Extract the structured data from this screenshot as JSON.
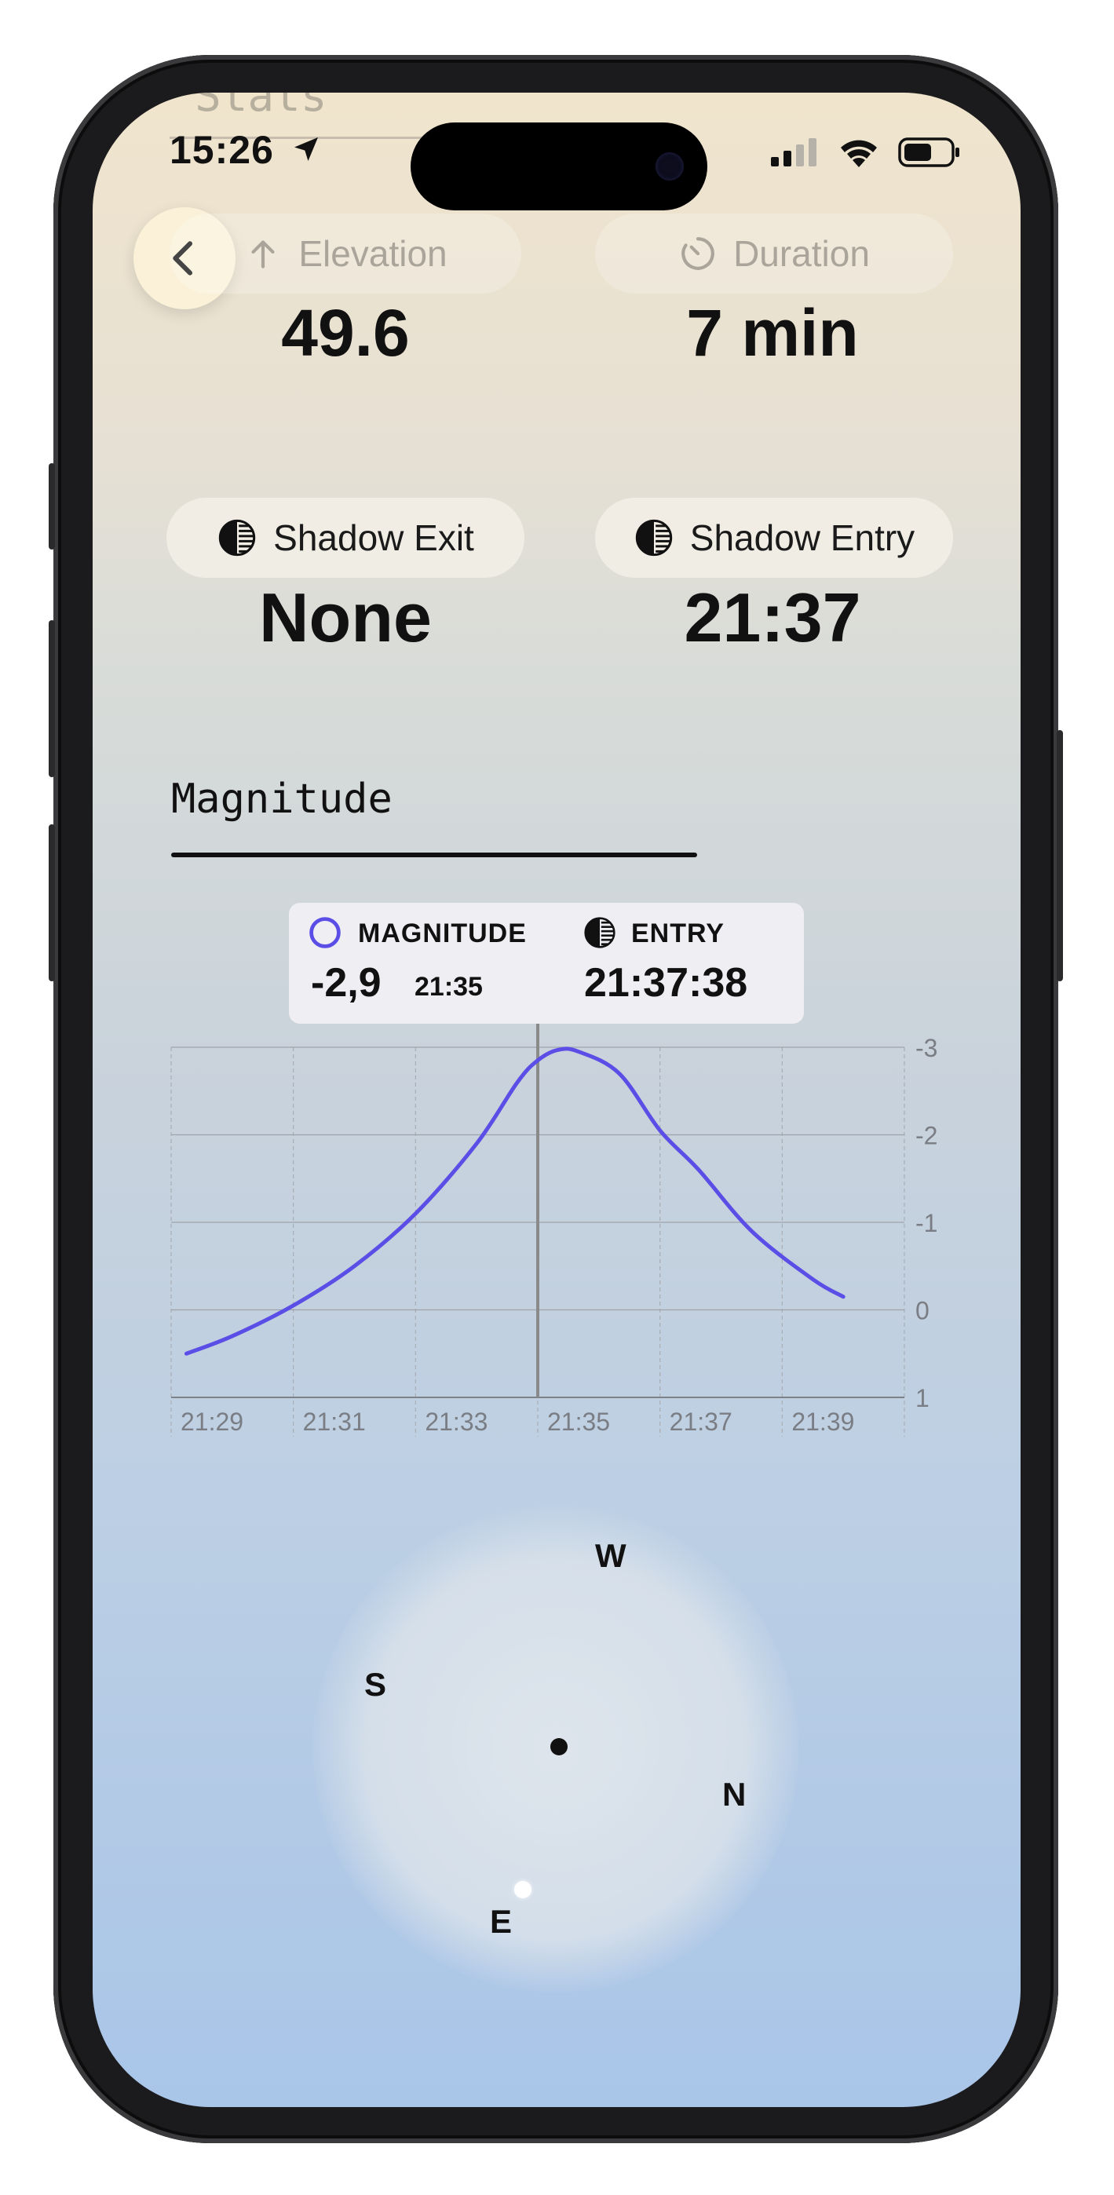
{
  "status_bar": {
    "time": "15:26"
  },
  "header": {
    "partial_title": "Stats"
  },
  "stats": [
    {
      "label": "Elevation",
      "value": "49.6",
      "icon": "arrow-up-icon"
    },
    {
      "label": "Duration",
      "value": "7 min",
      "icon": "timer-icon"
    },
    {
      "label": "Shadow Exit",
      "value": "None",
      "icon": "half-circle-icon"
    },
    {
      "label": "Shadow Entry",
      "value": "21:37",
      "icon": "half-circle-icon"
    }
  ],
  "section": {
    "title": "Magnitude"
  },
  "tooltip": {
    "magnitude_label": "MAGNITUDE",
    "magnitude_value": "-2,9",
    "magnitude_time": "21:35",
    "entry_label": "ENTRY",
    "entry_value": "21:37:38"
  },
  "chart_data": {
    "type": "line",
    "x_ticks": [
      "21:29",
      "21:31",
      "21:33",
      "21:35",
      "21:37",
      "21:39"
    ],
    "y_ticks": [
      "-3",
      "-2",
      "-1",
      "0",
      "1"
    ],
    "ylim": [
      1,
      -3
    ],
    "y_inverted": true,
    "grid": true,
    "series": [
      {
        "color": "#5b4ee6",
        "points": [
          [
            "21:29:15",
            0.5
          ],
          [
            "21:30:00",
            0.3
          ],
          [
            "21:31:00",
            -0.05
          ],
          [
            "21:32:00",
            -0.5
          ],
          [
            "21:33:00",
            -1.1
          ],
          [
            "21:34:00",
            -1.9
          ],
          [
            "21:34:40",
            -2.6
          ],
          [
            "21:35:00",
            -2.85
          ],
          [
            "21:35:20",
            -2.97
          ],
          [
            "21:35:40",
            -2.95
          ],
          [
            "21:36:20",
            -2.7
          ],
          [
            "21:37:00",
            -2.05
          ],
          [
            "21:37:38",
            -1.6
          ],
          [
            "21:38:30",
            -0.9
          ],
          [
            "21:39:30",
            -0.35
          ],
          [
            "21:40:00",
            -0.15
          ]
        ]
      }
    ],
    "cursor": {
      "time": "21:35",
      "color": "#8a8a8a"
    }
  },
  "compass": {
    "labels": [
      "W",
      "S",
      "N",
      "E"
    ]
  },
  "colors": {
    "accent": "#5b4ee6",
    "text": "#111111"
  }
}
